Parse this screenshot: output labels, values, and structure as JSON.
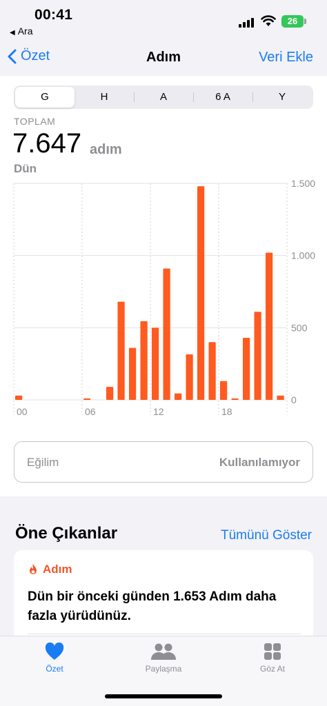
{
  "status_bar": {
    "time": "00:41",
    "back_app": "Ara",
    "battery": "26"
  },
  "nav": {
    "back_label": "Özet",
    "title": "Adım",
    "action_label": "Veri Ekle"
  },
  "segments": [
    "G",
    "H",
    "A",
    "6 A",
    "Y"
  ],
  "summary": {
    "label": "TOPLAM",
    "value": "7.647",
    "unit": "adım",
    "date": "Dün"
  },
  "chart_data": {
    "type": "bar",
    "x": [
      0,
      1,
      2,
      3,
      4,
      5,
      6,
      7,
      8,
      9,
      10,
      11,
      12,
      13,
      14,
      15,
      16,
      17,
      18,
      19,
      20,
      21,
      22,
      23
    ],
    "values": [
      30,
      0,
      0,
      0,
      0,
      0,
      10,
      0,
      90,
      680,
      360,
      545,
      500,
      910,
      45,
      315,
      1480,
      400,
      130,
      10,
      430,
      610,
      1020,
      30
    ],
    "x_tick_labels": [
      "00",
      "06",
      "12",
      "18"
    ],
    "y_tick_labels": [
      "1.500",
      "1.000",
      "500",
      "0"
    ],
    "ylim": [
      0,
      1500
    ],
    "bar_color": "#ff5a1f",
    "grid": true
  },
  "trend": {
    "label": "Eğilim",
    "value": "Kullanılamıyor"
  },
  "highlights": {
    "title": "Öne Çıkanlar",
    "show_all": "Tümünü Göster",
    "card": {
      "category": "Adım",
      "text": "Dün bir önceki günden 1.653 Adım daha fazla yürüdünüz."
    }
  },
  "tabs": [
    {
      "label": "Özet",
      "icon": "heart-icon",
      "active": true
    },
    {
      "label": "Paylaşma",
      "icon": "people-icon",
      "active": false
    },
    {
      "label": "Göz At",
      "icon": "grid-icon",
      "active": false
    }
  ],
  "colors": {
    "accent": "#1a7cf3",
    "bar": "#ff5a1f",
    "battery": "#34c759"
  }
}
